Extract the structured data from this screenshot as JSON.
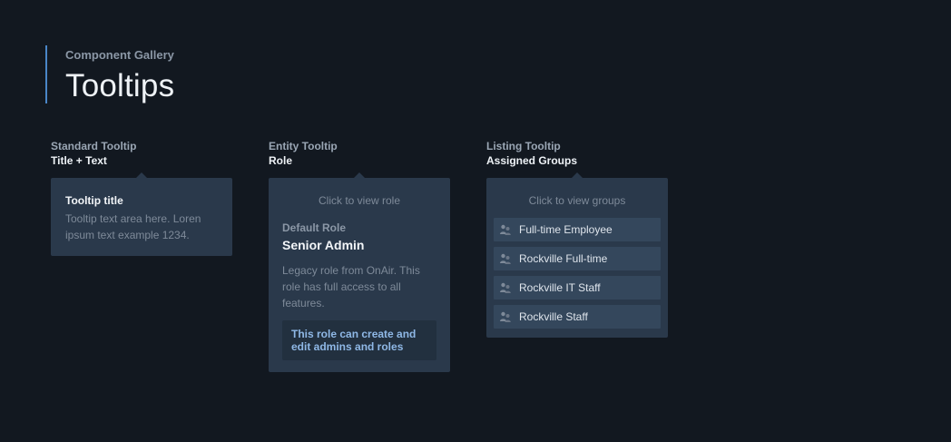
{
  "header": {
    "eyebrow": "Component Gallery",
    "title": "Tooltips"
  },
  "standard": {
    "label": "Standard Tooltip",
    "sublabel": "Title + Text",
    "tooltip_title": "Tooltip title",
    "tooltip_text": "Tooltip text area here. Loren ipsum text example 1234."
  },
  "entity": {
    "label": "Entity Tooltip",
    "sublabel": "Role",
    "click_hint": "Click to view role",
    "role_label": "Default Role",
    "role_name": "Senior Admin",
    "role_description": "Legacy role from OnAir. This role has full access to all features.",
    "callout": "This role can create and edit admins and roles"
  },
  "listing": {
    "label": "Listing Tooltip",
    "sublabel": "Assigned Groups",
    "click_hint": "Click to view groups",
    "items": [
      {
        "name": "Full-time Employee",
        "icon": "group-icon"
      },
      {
        "name": "Rockville Full-time",
        "icon": "group-icon"
      },
      {
        "name": "Rockville IT Staff",
        "icon": "group-icon"
      },
      {
        "name": "Rockville Staff",
        "icon": "group-icon"
      }
    ]
  },
  "colors": {
    "background": "#121820",
    "tooltip_bg": "#2a394b",
    "accent": "#4a86c8",
    "callout_text": "#8fb8e6"
  }
}
